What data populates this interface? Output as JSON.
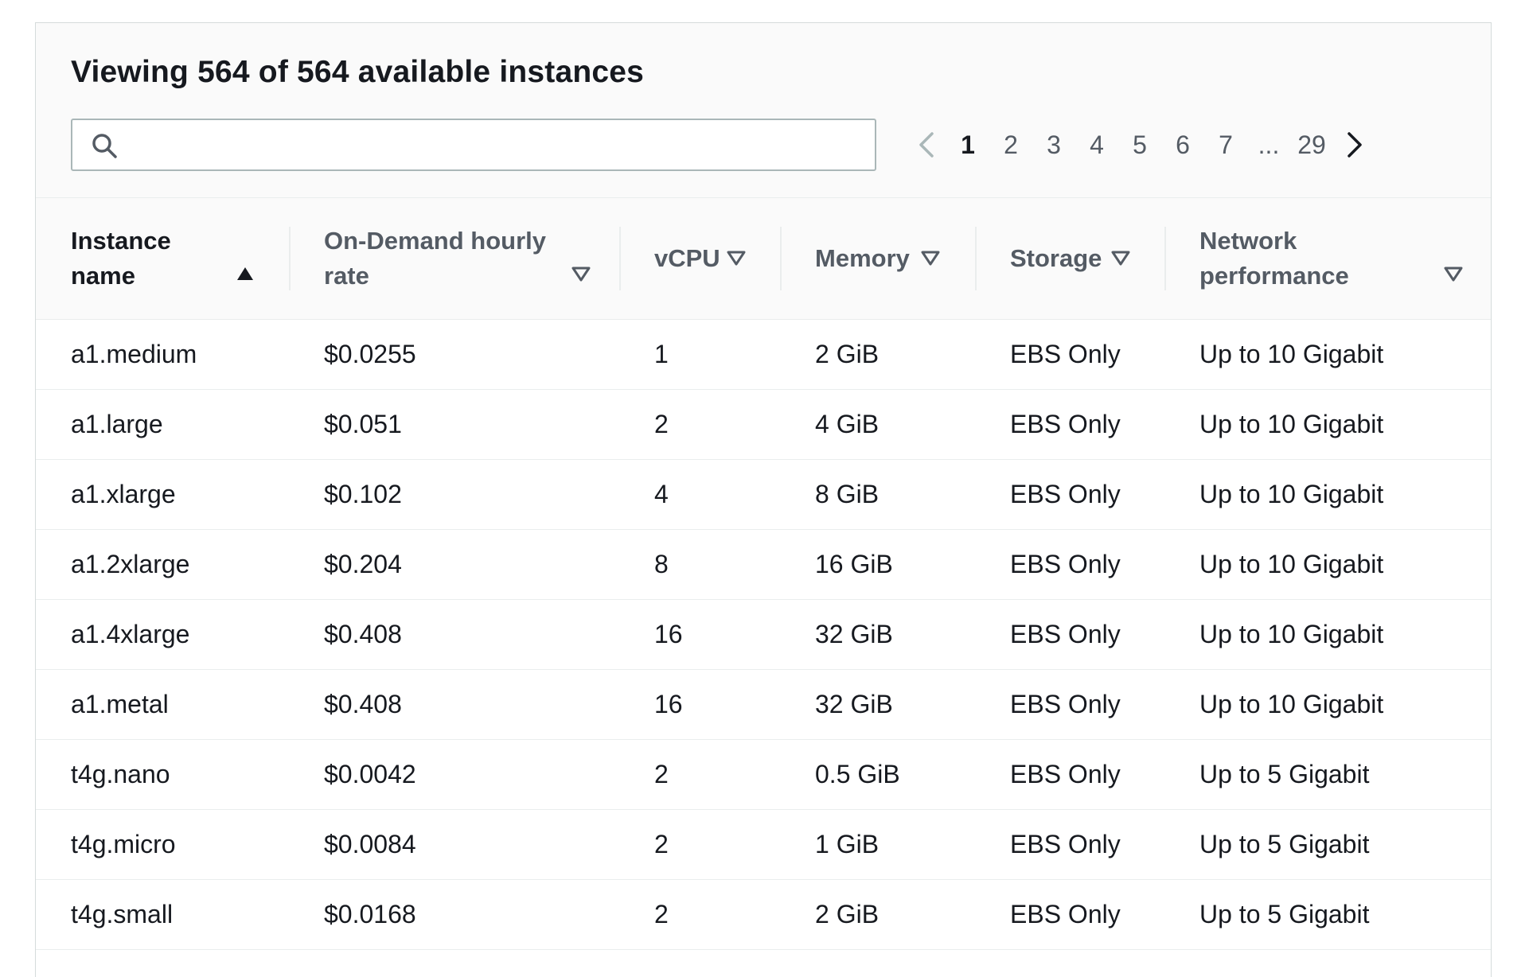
{
  "header": {
    "title": "Viewing 564 of 564 available instances",
    "search_placeholder": ""
  },
  "pagination": {
    "pages": [
      "1",
      "2",
      "3",
      "4",
      "5",
      "6",
      "7",
      "...",
      "29"
    ],
    "current": "1"
  },
  "table": {
    "columns": [
      {
        "label": "Instance name",
        "sort": "ascending"
      },
      {
        "label": "On-Demand hourly rate",
        "sort": "none"
      },
      {
        "label": "vCPU",
        "sort": "none"
      },
      {
        "label": "Memory",
        "sort": "none"
      },
      {
        "label": "Storage",
        "sort": "none"
      },
      {
        "label": "Network performance",
        "sort": "none"
      }
    ],
    "rows": [
      [
        "a1.medium",
        "$0.0255",
        "1",
        "2 GiB",
        "EBS Only",
        "Up to 10 Gigabit"
      ],
      [
        "a1.large",
        "$0.051",
        "2",
        "4 GiB",
        "EBS Only",
        "Up to 10 Gigabit"
      ],
      [
        "a1.xlarge",
        "$0.102",
        "4",
        "8 GiB",
        "EBS Only",
        "Up to 10 Gigabit"
      ],
      [
        "a1.2xlarge",
        "$0.204",
        "8",
        "16 GiB",
        "EBS Only",
        "Up to 10 Gigabit"
      ],
      [
        "a1.4xlarge",
        "$0.408",
        "16",
        "32 GiB",
        "EBS Only",
        "Up to 10 Gigabit"
      ],
      [
        "a1.metal",
        "$0.408",
        "16",
        "32 GiB",
        "EBS Only",
        "Up to 10 Gigabit"
      ],
      [
        "t4g.nano",
        "$0.0042",
        "2",
        "0.5 GiB",
        "EBS Only",
        "Up to 5 Gigabit"
      ],
      [
        "t4g.micro",
        "$0.0084",
        "2",
        "1 GiB",
        "EBS Only",
        "Up to 5 Gigabit"
      ],
      [
        "t4g.small",
        "$0.0168",
        "2",
        "2 GiB",
        "EBS Only",
        "Up to 5 Gigabit"
      ]
    ]
  },
  "icons": {
    "search": "search-icon",
    "prev": "chevron-left-icon",
    "next": "chevron-right-icon",
    "sort_asc": "sort-ascending-icon",
    "sort_none": "sort-descending-outline-icon"
  },
  "colors": {
    "text": "#16191f",
    "muted": "#545b64",
    "border": "#eaeded",
    "header_bg": "#fafafa"
  }
}
